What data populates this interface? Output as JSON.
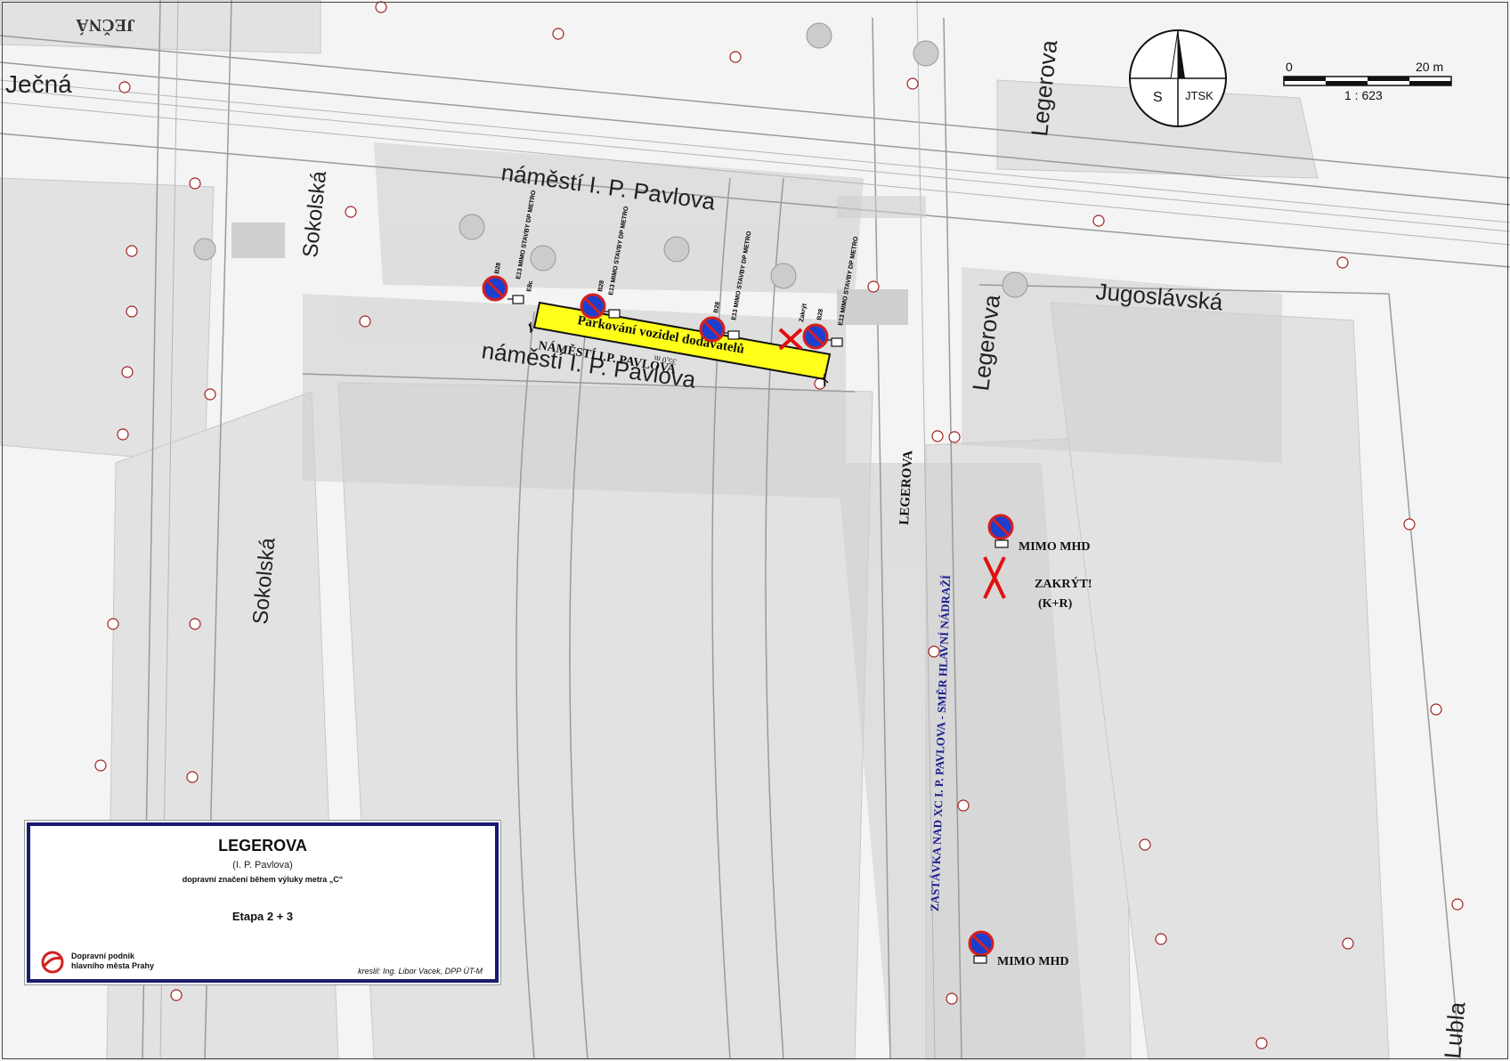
{
  "streets": {
    "jecna_top": "JEČNÁ",
    "jecna": "Ječná",
    "sokolska_upper": "Sokolská",
    "sokolska_lower": "Sokolská",
    "namesti_upper": "náměstí I. P. Pavlova",
    "namesti_lower": "náměstí I. P. Pavlova",
    "namesti_caps": "NÁMĚSTÍ I.P. PAVLOVA",
    "legerova_top": "Legerova",
    "legerova_mid": "Legerova",
    "legerova_caps": "LEGEROVA",
    "jugoslavska": "Jugoslávská",
    "lubla": "Lubla"
  },
  "compass": {
    "south_label": "S",
    "system_label": "JTSK"
  },
  "scale": {
    "zero": "0",
    "max": "20 m",
    "ratio": "1 : 623"
  },
  "parking_zone": {
    "label": "Parkování vozidel dodavatelů",
    "length": "35,0 m"
  },
  "signs": {
    "code": "B28",
    "sub_text": "E13 MIMO STAVBY DP METRO",
    "extra_code": "E8c",
    "covered": "Zakrýt"
  },
  "bus_stop": {
    "mimo_upper": "MIMO MHD",
    "mimo_lower": "MIMO MHD",
    "zakryt": "ZAKRÝT!",
    "kr": "(K+R)",
    "stop_label": "ZASTÁVKA NAD XC I. P. PAVLOVA - SMĚR HLAVNÍ NÁDRAŽÍ"
  },
  "title_block": {
    "title": "LEGEROVA",
    "subtitle": "(I.  P. Pavlova)",
    "description": "dopravní značení během výluky  metra „C“",
    "stage": "Etapa 2 + 3",
    "org_line1": "Dopravní podnik",
    "org_line2": "hlavního města Prahy",
    "author": "kreslil: Ing. Libor Vacek, DPP ÚT-M"
  },
  "colors": {
    "sign_red": "#d42020",
    "sign_blue": "#1c3fd0",
    "zone_yellow": "#ffff1a",
    "stop_text_blue": "#1a1a8c",
    "cross_red": "#e01010",
    "frame_blue": "#1a1a6e"
  }
}
